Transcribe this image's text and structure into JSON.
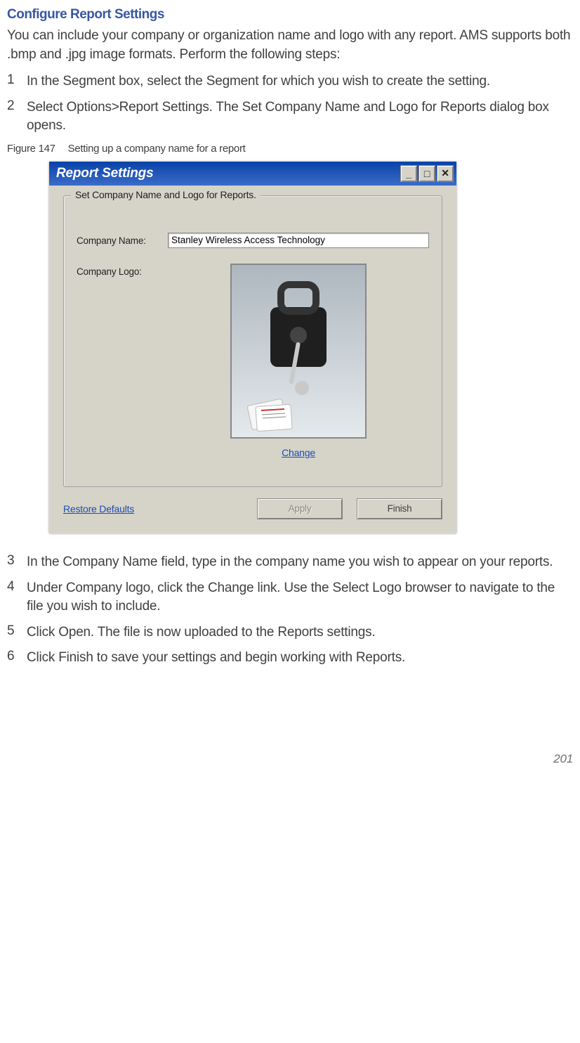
{
  "section": {
    "heading": "Configure Report Settings",
    "intro": "You can include your company or organization name and logo with any report. AMS supports both .bmp and .jpg image formats. Perform the following steps:"
  },
  "steps_top": [
    {
      "num": "1",
      "text": "In the Segment box, select the Segment for which you wish to create the setting."
    },
    {
      "num": "2",
      "text": "Select Options>Report Settings. The Set Company Name and Logo for Reports dialog box opens."
    }
  ],
  "figure": {
    "label": "Figure 147",
    "caption": "Setting up a company name for a report"
  },
  "dialog": {
    "title": "Report Settings",
    "group_title": "Set Company Name and Logo for Reports.",
    "fields": {
      "company_name_label": "Company Name:",
      "company_name_value": "Stanley Wireless Access Technology",
      "company_logo_label": "Company Logo:"
    },
    "links": {
      "change": "Change",
      "restore": "Restore Defaults"
    },
    "buttons": {
      "apply": "Apply",
      "finish": "Finish"
    },
    "title_buttons": {
      "minimize": "_",
      "maximize": "□",
      "close": "✕"
    }
  },
  "steps_bottom": [
    {
      "num": "3",
      "text": "In the Company Name field, type in the company name you wish to appear on your reports."
    },
    {
      "num": "4",
      "text": "Under Company logo, click the Change link. Use the Select Logo browser to navigate to the file you wish to include."
    },
    {
      "num": "5",
      "text": "Click Open. The file is now uploaded to the Reports settings."
    },
    {
      "num": "6",
      "text": "Click Finish to save your settings and begin working with Reports."
    }
  ],
  "page_number": "201"
}
